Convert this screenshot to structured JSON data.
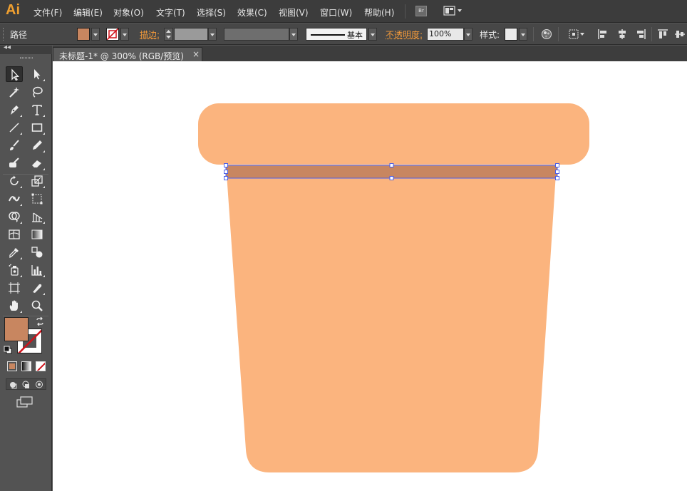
{
  "app": {
    "logo": "Ai"
  },
  "menu": {
    "items": [
      {
        "label": "文件(F)"
      },
      {
        "label": "编辑(E)"
      },
      {
        "label": "对象(O)"
      },
      {
        "label": "文字(T)"
      },
      {
        "label": "选择(S)"
      },
      {
        "label": "效果(C)"
      },
      {
        "label": "视图(V)"
      },
      {
        "label": "窗口(W)"
      },
      {
        "label": "帮助(H)"
      }
    ],
    "bridge_label": "Br"
  },
  "control_bar": {
    "selection_type": "路径",
    "fill_color": "#c88660",
    "stroke_label": "描边:",
    "stroke_profile": "基本",
    "opacity_label": "不透明度:",
    "opacity_value": "100%",
    "style_label": "样式:"
  },
  "document": {
    "tab_title": "未标题-1* @ 300% (RGB/预览)",
    "close_glyph": "×"
  },
  "tools": {
    "fill_color": "#c88660",
    "active_tool": "selection-tool"
  },
  "artwork": {
    "pot_color": "#fbb47e",
    "band_color": "#c88660",
    "selection_color": "#4a5ee8"
  }
}
